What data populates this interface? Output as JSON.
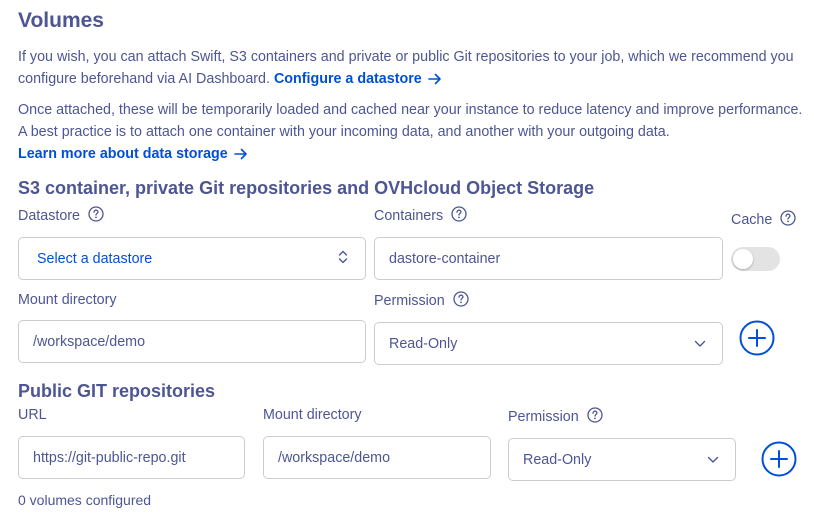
{
  "volumes": {
    "title": "Volumes",
    "intro_text": "If you wish, you can attach Swift, S3 containers and private or public Git repositories to your job, which we recommend you configure beforehand via AI Dashboard.",
    "configure_link": "Configure a datastore",
    "cache_text": "Once attached, these will be temporarily loaded and cached near your instance to reduce latency and improve performance. A best practice is to attach one container with your incoming data, and another with your outgoing data.",
    "learn_more_link": "Learn more about data storage"
  },
  "s3_section": {
    "title": "S3 container, private Git repositories and OVHcloud Object Storage",
    "datastore_label": "Datastore",
    "datastore_value": "Select a datastore",
    "containers_label": "Containers",
    "containers_placeholder": "dastore-container",
    "cache_label": "Cache",
    "cache_enabled": false,
    "mount_label": "Mount directory",
    "mount_placeholder": "/workspace/demo",
    "permission_label": "Permission",
    "permission_value": "Read-Only"
  },
  "git_section": {
    "title": "Public GIT repositories",
    "url_label": "URL",
    "url_placeholder": "https://git-public-repo.git",
    "mount_label": "Mount directory",
    "mount_placeholder": "/workspace/demo",
    "permission_label": "Permission",
    "permission_value": "Read-Only"
  },
  "status": {
    "volumes_configured": "0 volumes configured"
  },
  "colors": {
    "text": "#4d5693",
    "link": "#0050d7",
    "border": "#cccccc",
    "toggle_off": "#e3e3e3"
  },
  "icons": {
    "help": "question-circle-icon",
    "arrow": "arrow-right-icon",
    "add": "plus-circle-icon",
    "select": "chevron-up-down-icon",
    "dropdown": "chevron-down-icon"
  }
}
